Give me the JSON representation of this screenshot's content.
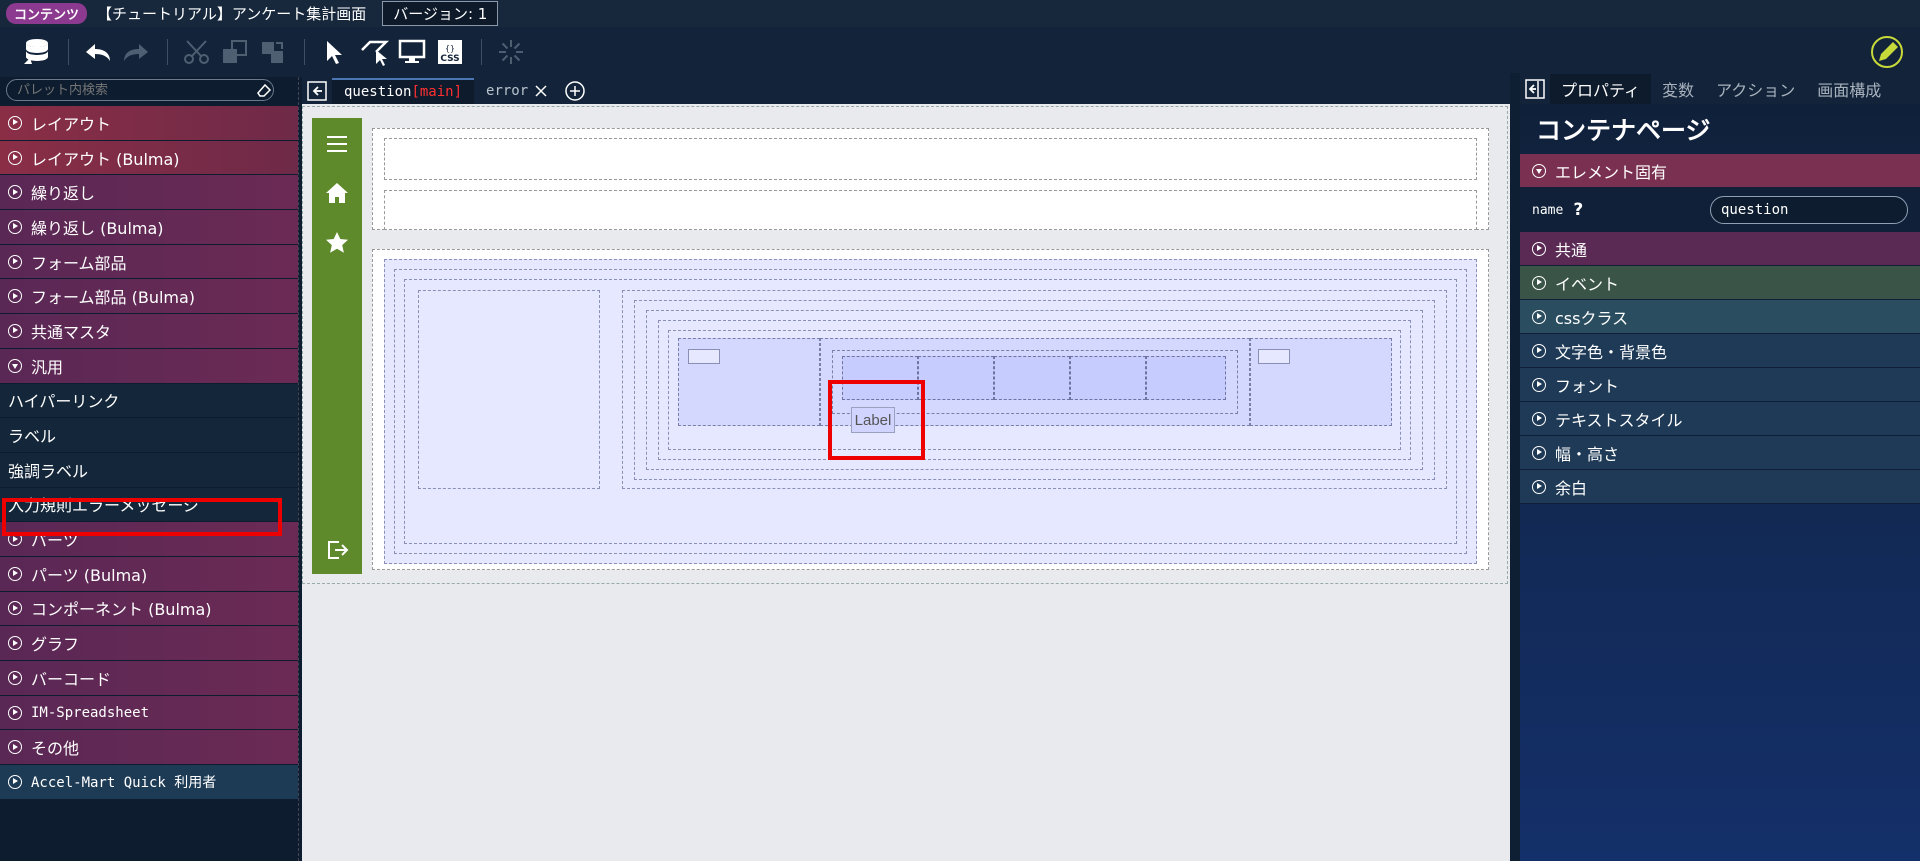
{
  "titlebar": {
    "badge": "コンテンツ",
    "title": "【チュートリアル】アンケート集計画面",
    "version": "バージョン: 1"
  },
  "toolbar": {
    "icons": [
      "database-icon",
      "undo-icon",
      "redo-icon",
      "cut-icon",
      "copy-icon",
      "paste-icon",
      "select-pointer-icon",
      "area-select-icon",
      "monitor-icon",
      "css-icon",
      "loading-spinner-icon",
      "edit-pencil-icon"
    ]
  },
  "palette": {
    "search_placeholder": "パレット内検索",
    "items": [
      {
        "label": "レイアウト",
        "style": "red",
        "expanded": false
      },
      {
        "label": "レイアウト (Bulma)",
        "style": "red",
        "expanded": false
      },
      {
        "label": "繰り返し",
        "style": "purple",
        "expanded": false
      },
      {
        "label": "繰り返し (Bulma)",
        "style": "purple",
        "expanded": false
      },
      {
        "label": "フォーム部品",
        "style": "purple",
        "expanded": false
      },
      {
        "label": "フォーム部品 (Bulma)",
        "style": "purple",
        "expanded": false
      },
      {
        "label": "共通マスタ",
        "style": "purple",
        "expanded": false
      },
      {
        "label": "汎用",
        "style": "purple",
        "expanded": true
      }
    ],
    "sub_items": [
      "ハイパーリンク",
      "ラベル",
      "強調ラベル",
      "入力規則エラーメッセージ"
    ],
    "items2": [
      {
        "label": "パーツ",
        "style": "purple"
      },
      {
        "label": "パーツ (Bulma)",
        "style": "purple"
      },
      {
        "label": "コンポーネント (Bulma)",
        "style": "purple"
      },
      {
        "label": "グラフ",
        "style": "purple"
      },
      {
        "label": "バーコード",
        "style": "purple"
      },
      {
        "label": "IM-Spreadsheet",
        "style": "purple"
      },
      {
        "label": "その他",
        "style": "purple"
      },
      {
        "label": "Accel-Mart Quick 利用者",
        "style": "teal"
      }
    ]
  },
  "editor": {
    "tabs": [
      {
        "label": "question",
        "suffix": "[main]",
        "active": true
      },
      {
        "label": "error",
        "active": false
      }
    ],
    "canvas_label": "Label"
  },
  "properties": {
    "tabs": [
      "プロパティ",
      "変数",
      "アクション",
      "画面構成"
    ],
    "title": "コンテナページ",
    "section_element": "エレメント固有",
    "name_label": "name",
    "help": "?",
    "name_value": "question",
    "sections": [
      "共通",
      "イベント",
      "cssクラス",
      "文字色・背景色",
      "フォント",
      "テキストスタイル",
      "幅・高さ",
      "余白"
    ]
  }
}
